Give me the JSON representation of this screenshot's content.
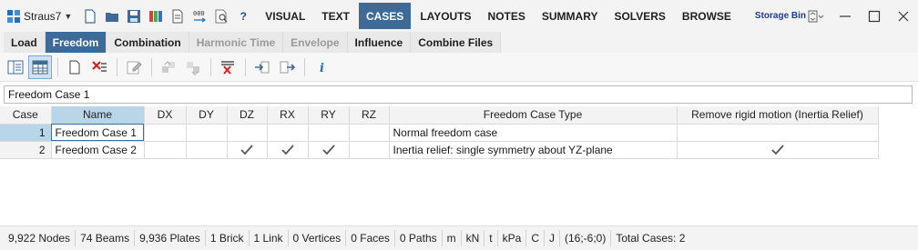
{
  "app": {
    "name": "Straus7",
    "icon": "straus7-logo-icon"
  },
  "quick_access": {
    "icons": [
      "new-file-icon",
      "open-folder-icon",
      "save-icon",
      "color-palette-icon",
      "document-icon",
      "number-format-icon",
      "print-preview-icon"
    ],
    "help_label": "?"
  },
  "ribbon": {
    "tabs": [
      "VISUAL",
      "TEXT",
      "CASES",
      "LAYOUTS",
      "NOTES",
      "SUMMARY",
      "SOLVERS",
      "BROWSE"
    ],
    "active_tab": "CASES",
    "storage_bin": "Storage Bin"
  },
  "subtabs": {
    "items": [
      {
        "label": "Load",
        "state": "normal"
      },
      {
        "label": "Freedom",
        "state": "active"
      },
      {
        "label": "Combination",
        "state": "normal"
      },
      {
        "label": "Harmonic Time",
        "state": "disabled"
      },
      {
        "label": "Envelope",
        "state": "disabled"
      },
      {
        "label": "Influence",
        "state": "normal"
      },
      {
        "label": "Combine Files",
        "state": "normal"
      }
    ]
  },
  "toolbar": {
    "icons": [
      "list-view-icon",
      "table-view-icon",
      "new-case-icon",
      "delete-case-icon",
      "edit-icon",
      "move-up-icon",
      "move-down-icon",
      "delete-all-icon",
      "import-icon",
      "export-icon",
      "info-icon"
    ]
  },
  "case_name": {
    "value": "Freedom Case 1"
  },
  "table": {
    "headers": [
      "Case",
      "Name",
      "DX",
      "DY",
      "DZ",
      "RX",
      "RY",
      "RZ",
      "Freedom Case Type",
      "Remove rigid motion (Inertia Relief)"
    ],
    "rows": [
      {
        "case": "1",
        "name": "Freedom Case 1",
        "dx": false,
        "dy": false,
        "dz": false,
        "rx": false,
        "ry": false,
        "rz": false,
        "type": "Normal freedom case",
        "inertia": false
      },
      {
        "case": "2",
        "name": "Freedom Case 2",
        "dx": false,
        "dy": false,
        "dz": true,
        "rx": true,
        "ry": true,
        "rz": false,
        "type": "Inertia relief: single symmetry about YZ-plane",
        "inertia": true
      }
    ]
  },
  "status": {
    "nodes": "9,922 Nodes",
    "beams": "74 Beams",
    "plates": "9,936 Plates",
    "bricks": "1 Brick",
    "links": "1 Link",
    "vertices": "0 Vertices",
    "faces": "0 Faces",
    "paths": "0 Paths",
    "unit_length": "m",
    "unit_force": "kN",
    "unit_mass": "t",
    "unit_stress": "kPa",
    "unit_temp": "C",
    "unit_energy": "J",
    "coords": "(16;-6;0)",
    "total_cases": "Total Cases: 2"
  },
  "colors": {
    "accent": "#3d6a96",
    "selection": "#b8d6e8"
  }
}
